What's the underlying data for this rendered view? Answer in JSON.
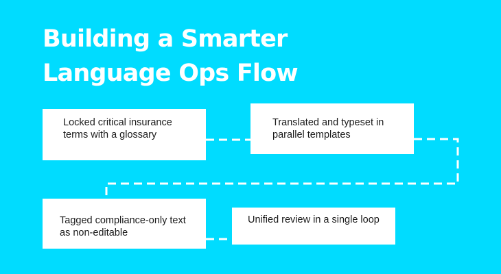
{
  "title": {
    "line1": "Building a Smarter",
    "line2": "Language Ops Flow"
  },
  "steps": [
    {
      "text": "Locked critical insurance terms with a glossary"
    },
    {
      "text": "Translated and typeset in parallel templates"
    },
    {
      "text": "Tagged compliance-only text as non-editable"
    },
    {
      "text": "Unified review in a single loop"
    }
  ],
  "colors": {
    "background": "#00dcff",
    "card": "#ffffff",
    "connector": "#ffffff",
    "title": "#ffffff",
    "text": "#1a1a1a"
  }
}
